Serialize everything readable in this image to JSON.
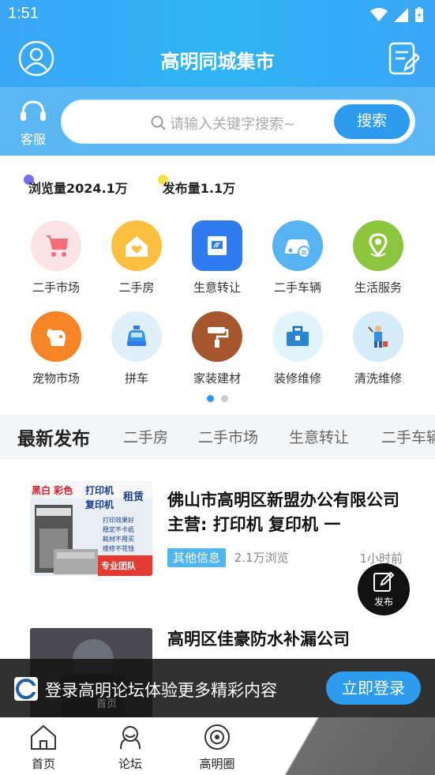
{
  "status": {
    "time": "1:51"
  },
  "header": {
    "title": "高明同城集市"
  },
  "service": {
    "label": "客服"
  },
  "search": {
    "placeholder": "请输入关键字搜索~",
    "button": "搜索"
  },
  "stats": [
    {
      "text": "浏览量2024.1万",
      "dot_color": "#7b6cf0"
    },
    {
      "text": "发布量1.1万",
      "dot_color": "#f5e04a"
    }
  ],
  "categories": [
    {
      "label": "二手市场",
      "icon": "stroller-icon"
    },
    {
      "label": "二手房",
      "icon": "house-heart-icon"
    },
    {
      "label": "生意转让",
      "icon": "shop-icon"
    },
    {
      "label": "二手车辆",
      "icon": "car-icon"
    },
    {
      "label": "生活服务",
      "icon": "location-pin-icon"
    },
    {
      "label": "宠物市场",
      "icon": "dog-icon"
    },
    {
      "label": "拼车",
      "icon": "taxi-icon"
    },
    {
      "label": "家装建材",
      "icon": "paint-roller-icon"
    },
    {
      "label": "装修维修",
      "icon": "toolbox-icon"
    },
    {
      "label": "清洗维修",
      "icon": "cleaner-icon"
    }
  ],
  "tabs": {
    "latest": "最新发布",
    "items": [
      "二手房",
      "二手市场",
      "生意转让",
      "二手车辆"
    ]
  },
  "posts": [
    {
      "title": "佛山市高明区新盟办公有限公司 主营: 打印机 复印机 一",
      "tag": "其他信息",
      "views": "2.1万浏览",
      "time": "1小时前",
      "thumb_text": [
        "黑白 彩色",
        "打印机",
        "复印机",
        "租赁",
        "打印效果好",
        "稳定不卡纸",
        "耗材不用买",
        "维修不花钱",
        "专业团队"
      ]
    },
    {
      "title": "高明区佳豪防水补漏公司"
    }
  ],
  "fab": {
    "label": "发布"
  },
  "banner": {
    "message": "登录高明论坛体验更多精彩内容",
    "login": "立即登录"
  },
  "tabbar": [
    {
      "label": "首页",
      "icon": "home-icon"
    },
    {
      "label": "论坛",
      "icon": "forum-icon"
    },
    {
      "label": "高明圈",
      "icon": "circle-icon"
    }
  ]
}
